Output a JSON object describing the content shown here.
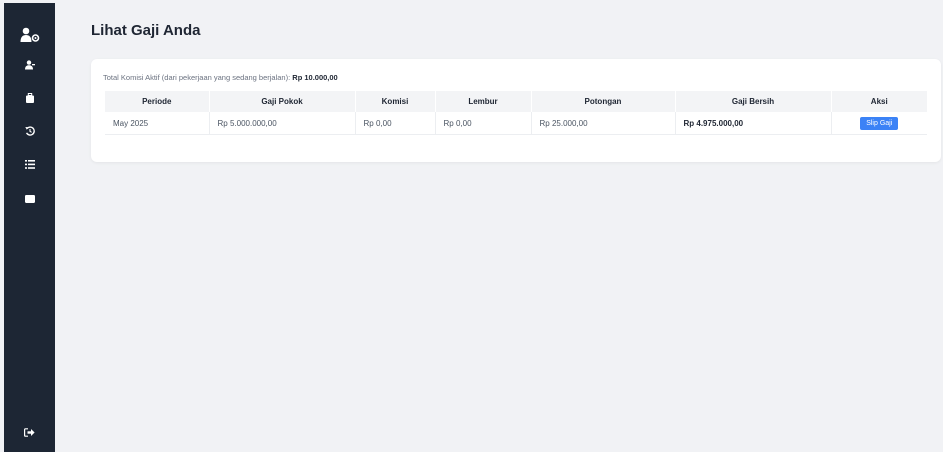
{
  "sidebar": {
    "items": [
      {
        "icon": "user-gear-icon"
      },
      {
        "icon": "user-icon"
      },
      {
        "icon": "briefcase-icon"
      },
      {
        "icon": "history-icon"
      },
      {
        "icon": "list-icon"
      },
      {
        "icon": "wallet-icon"
      }
    ],
    "logout_icon": "sign-out-icon"
  },
  "page": {
    "title": "Lihat Gaji Anda"
  },
  "commission": {
    "label": "Total Komisi Aktif (dari pekerjaan yang sedang berjalan):",
    "value": "Rp 10.000,00"
  },
  "table": {
    "headers": [
      "Periode",
      "Gaji Pokok",
      "Komisi",
      "Lembur",
      "Potongan",
      "Gaji Bersih",
      "Aksi"
    ],
    "rows": [
      {
        "periode": "May 2025",
        "gaji_pokok": "Rp 5.000.000,00",
        "komisi": "Rp 0,00",
        "lembur": "Rp 0,00",
        "potongan": "Rp 25.000,00",
        "gaji_bersih": "Rp 4.975.000,00",
        "aksi_label": "Slip Gaji"
      }
    ]
  },
  "colors": {
    "sidebar": "#1d2634",
    "accent": "#3b82f6",
    "background": "#f1f2f5"
  }
}
